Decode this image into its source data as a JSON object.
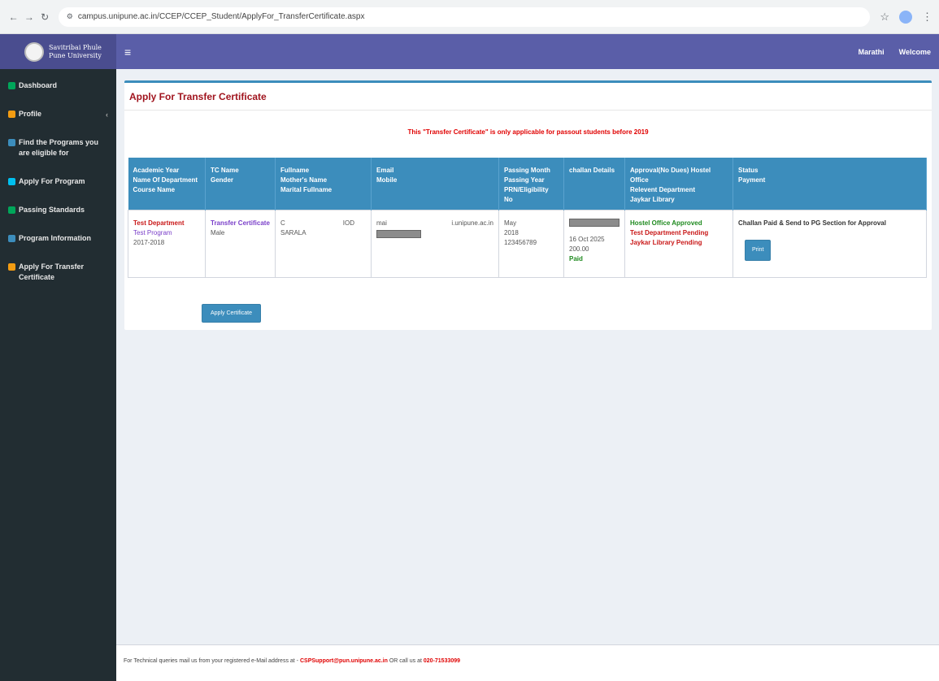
{
  "browser": {
    "url": "campus.unipune.ac.in/CCEP/CCEP_Student/ApplyFor_TransferCertificate.aspx"
  },
  "header": {
    "logo_line1": "Savitribai Phule",
    "logo_line2": "Pune University",
    "marathi_label": "Marathi",
    "welcome_label": "Welcome"
  },
  "sidebar": {
    "items": [
      {
        "label": "Dashboard",
        "color": "#00a65a"
      },
      {
        "label": "Profile",
        "color": "#f39c12"
      },
      {
        "label": "Find the Programs you are eligible for",
        "color": "#3c8dbc"
      },
      {
        "label": "Apply For Program",
        "color": "#00c0ef"
      },
      {
        "label": "Passing Standards",
        "color": "#00a65a"
      },
      {
        "label": "Program Information",
        "color": "#3c8dbc"
      },
      {
        "label": "Apply For Transfer Certificate",
        "color": "#f39c12"
      }
    ]
  },
  "card": {
    "title": "Apply For Transfer Certificate",
    "notice": "This \"Transfer Certificate\" is only applicable for passout students before 2019"
  },
  "table": {
    "headers": [
      [
        "Academic Year",
        "Name Of Department",
        "Course Name"
      ],
      [
        "TC Name",
        "Gender"
      ],
      [
        "Fullname",
        "Mother's Name",
        "Marital Fullname"
      ],
      [
        "Email",
        "Mobile"
      ],
      [
        "Passing Month",
        "Passing Year",
        "PRN/Eligibility No"
      ],
      [
        "challan Details"
      ],
      [
        "Approval(No Dues) Hostel Office",
        "Relevent Department",
        "Jaykar Library"
      ],
      [
        "Status",
        "Payment"
      ]
    ],
    "row": {
      "department": "Test Department",
      "program": "Test Program",
      "academic_year": "2017-2018",
      "tc_name": "Transfer Certificate",
      "gender": "Male",
      "fullname_start": "C",
      "fullname_end": "IOD",
      "mother_name": "SARALA",
      "email_start": "mai",
      "email_end": "i.unipune.ac.in",
      "passing_month": "May",
      "passing_year": "2018",
      "prn": "123456789",
      "challan_date": "16 Oct 2025",
      "challan_amount": "200.00",
      "challan_status": "Paid",
      "hostel_status": "Hostel Office Approved",
      "department_status": "Test Department Pending",
      "library_status": "Jaykar Library Pending",
      "status_text": "Challan Paid & Send to PG Section for Approval",
      "print_label": "Print"
    }
  },
  "apply_button_label": "Apply Certificate",
  "footer": {
    "text": "For Technical queries mail us from your registered e-Mail address at -",
    "email": "CSPSupport@pun.unipune.ac.in",
    "or_call": "OR call us at",
    "phone": "020-71533099"
  }
}
